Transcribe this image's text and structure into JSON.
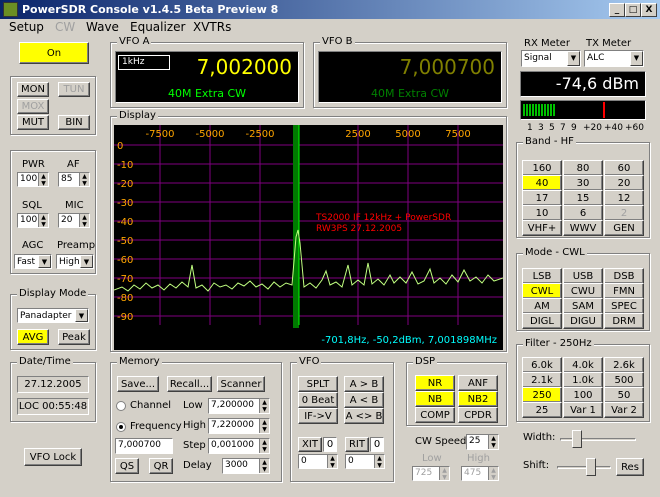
{
  "window": {
    "title": "PowerSDR Console v1.4.5 Beta Preview 8",
    "min": "_",
    "max": "□",
    "close": "X"
  },
  "menu": [
    "Setup",
    "CW",
    "Wave",
    "Equalizer",
    "XVTRs"
  ],
  "power_button": "On",
  "toggles": {
    "mon": "MON",
    "tun": "TUN",
    "mox": "MOX",
    "mut": "MUT",
    "bin": "BIN"
  },
  "gain": {
    "pwr_label": "PWR",
    "pwr": "100",
    "af_label": "AF",
    "af": "85",
    "sql_label": "SQL",
    "sql": "100",
    "mic_label": "MIC",
    "mic": "20",
    "agc_label": "AGC",
    "agc": "Fast",
    "preamp_label": "Preamp",
    "preamp": "High"
  },
  "display_mode": {
    "title": "Display Mode",
    "mode": "Panadapter",
    "avg": "AVG",
    "peak": "Peak"
  },
  "datetime": {
    "title": "Date/Time",
    "date": "27.12.2005",
    "time": "LOC 00:55:48"
  },
  "vfo_lock": "VFO Lock",
  "vfo_a": {
    "title": "VFO A",
    "step": "1kHz",
    "freq": "7,002000",
    "band": "40M Extra CW"
  },
  "vfo_b": {
    "title": "VFO B",
    "freq": "7,000700",
    "band": "40M Extra CW"
  },
  "display": {
    "title": "Display",
    "x_ticks": [
      "-7500",
      "-5000",
      "-2500",
      "2500",
      "5000",
      "7500"
    ],
    "y_ticks": [
      "0",
      "-10",
      "-20",
      "-30",
      "-40",
      "-50",
      "-60",
      "-70",
      "-80",
      "-90"
    ],
    "annotation_line1": "TS2000 IF 12kHz + PowerSDR",
    "annotation_line2": "RW3PS 27.12.2005",
    "readout": "-701,8Hz, -50,2dBm, 7,001898MHz"
  },
  "memory": {
    "title": "Memory",
    "save": "Save...",
    "recall": "Recall...",
    "scanner": "Scanner",
    "channel": "Channel",
    "frequency": "Frequency",
    "low_label": "Low",
    "low": "7,200000",
    "high_label": "High",
    "high": "7,220000",
    "step_label": "Step",
    "step": "0,001000",
    "delay_label": "Delay",
    "delay": "3000",
    "entry": "7,000700",
    "qs": "QS",
    "qr": "QR"
  },
  "vfo": {
    "title": "VFO",
    "splt": "SPLT",
    "a_to_b": "A > B",
    "zero_beat": "0 Beat",
    "a_from_b": "A < B",
    "if_v": "IF->V",
    "a_swap_b": "A <> B",
    "xit": "XIT",
    "xit_val": "0",
    "xit_field": "0",
    "rit": "RIT",
    "rit_val": "0",
    "rit_field": "0"
  },
  "dsp": {
    "title": "DSP",
    "nr": "NR",
    "anf": "ANF",
    "nb": "NB",
    "nb2": "NB2",
    "comp": "COMP",
    "cpdr": "CPDR"
  },
  "cw_speed": {
    "label": "CW Speed:",
    "value": "25",
    "low_label": "Low",
    "low": "725",
    "high_label": "High",
    "high": "475"
  },
  "meters": {
    "rx_title": "RX Meter",
    "rx_mode": "Signal",
    "tx_title": "TX Meter",
    "tx_mode": "ALC",
    "value": "-74,6 dBm",
    "scale": [
      "1",
      "3",
      "5",
      "7",
      "9",
      "+20",
      "+40",
      "+60"
    ],
    "level_fraction": 0.27
  },
  "band": {
    "title": "Band - HF",
    "buttons": [
      "160",
      "80",
      "60",
      "40",
      "30",
      "20",
      "17",
      "15",
      "12",
      "10",
      "6",
      "2",
      "VHF+",
      "WWV",
      "GEN"
    ]
  },
  "mode": {
    "title": "Mode - CWL",
    "buttons": [
      "LSB",
      "USB",
      "DSB",
      "CWL",
      "CWU",
      "FMN",
      "AM",
      "SAM",
      "SPEC",
      "DIGL",
      "DIGU",
      "DRM"
    ]
  },
  "filter": {
    "title": "Filter - 250Hz",
    "buttons": [
      "6.0k",
      "4.0k",
      "2.6k",
      "2.1k",
      "1.0k",
      "500",
      "250",
      "100",
      "50",
      "25",
      "Var 1",
      "Var 2"
    ],
    "width_label": "Width:",
    "shift_label": "Shift:",
    "reset": "Res"
  },
  "colors": {
    "on": "#ffff00",
    "freq_a": "#ffff00",
    "freq_b": "#808000",
    "band_a": "#00ff00",
    "band_b": "#008000",
    "trace": "#c0ff80",
    "grid": "#800080",
    "tick": "#ffa500",
    "annotation": "#ff0000",
    "readout": "#00ffff"
  }
}
